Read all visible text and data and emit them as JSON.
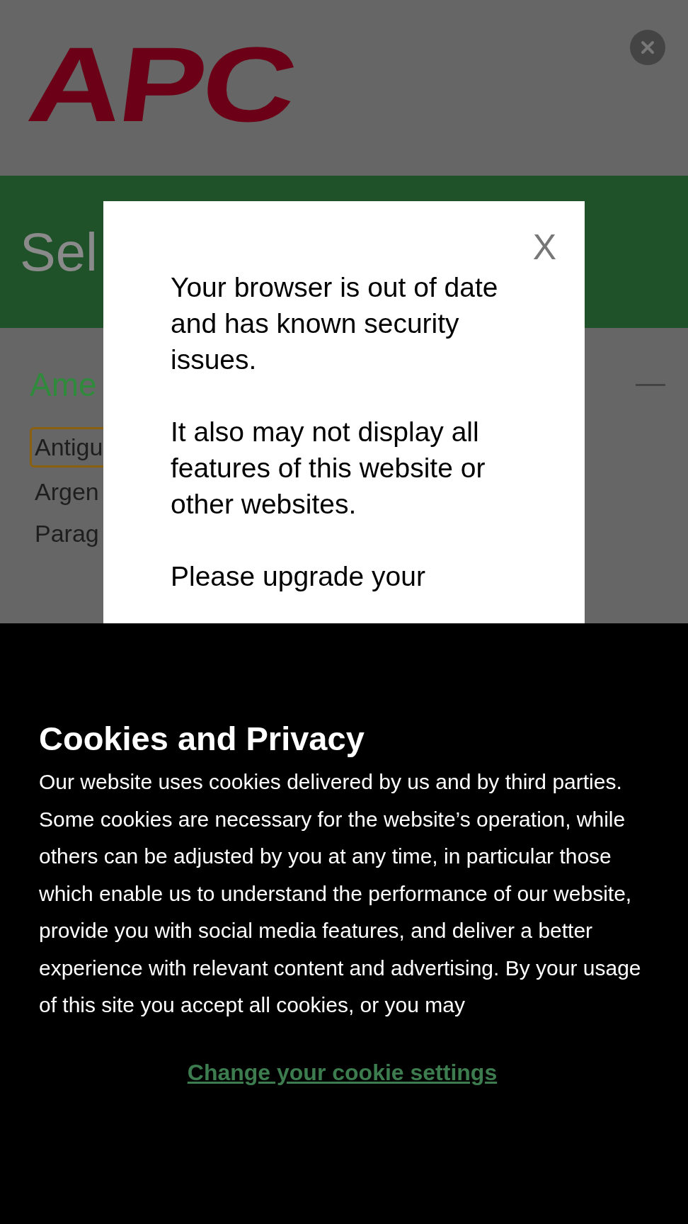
{
  "header": {
    "logo": "APC"
  },
  "banner": {
    "title": "Sel"
  },
  "region": {
    "title": "Ame",
    "expanded": true,
    "countries": [
      {
        "name": "Antigu",
        "selected": true
      },
      {
        "name": "Argen",
        "selected": false
      },
      {
        "name": "Parag",
        "selected": false
      }
    ]
  },
  "browser_warning": {
    "close": "X",
    "paragraphs": [
      "Your browser is out of date and has known security issues.",
      "It also may not display all features of this website or other websites.",
      "Please upgrade your"
    ]
  },
  "cookie_banner": {
    "title": "Cookies and Privacy",
    "body": "Our website uses cookies delivered by us and by third parties. Some cookies are necessary for the website’s operation, while others can be adjusted by you at any time, in particular those which enable us to understand the performance of our website, provide you with social media features, and deliver a better experience with relevant content and advertising. By your usage of this site you accept all cookies, or you may",
    "link": "Change your cookie settings"
  }
}
